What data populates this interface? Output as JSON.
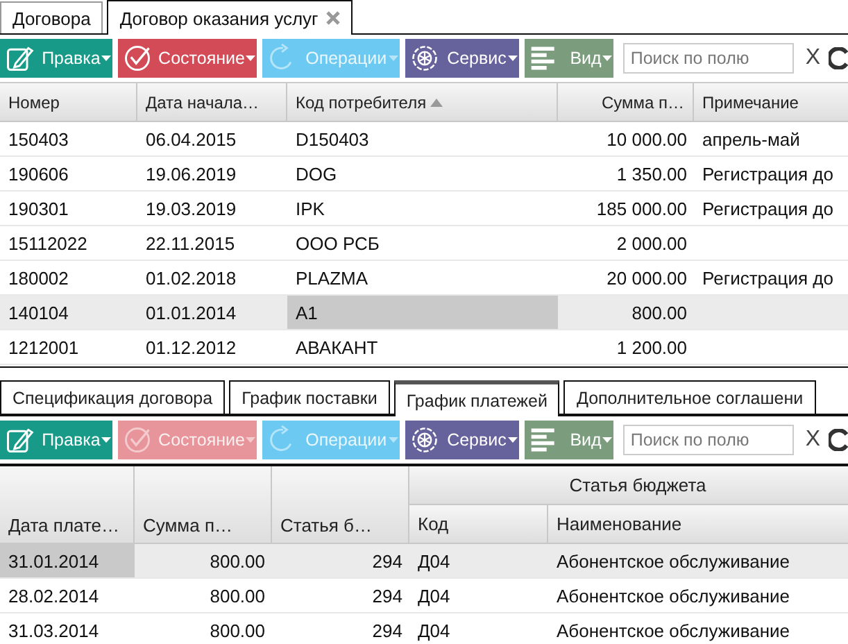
{
  "top_tabs": [
    {
      "label": "Договора",
      "selected": false,
      "closable": false
    },
    {
      "label": "Договор оказания услуг",
      "selected": true,
      "closable": true
    }
  ],
  "top_toolbar": {
    "buttons": [
      {
        "kind": "edit",
        "label": "Правка",
        "disabled": false
      },
      {
        "kind": "state",
        "label": "Состояние",
        "disabled": false
      },
      {
        "kind": "operations",
        "label": "Операции",
        "disabled": true
      },
      {
        "kind": "service",
        "label": "Сервис",
        "disabled": false
      },
      {
        "kind": "view",
        "label": "Вид",
        "disabled": false
      }
    ],
    "search": {
      "placeholder": "Поиск по полю"
    },
    "clear": "X"
  },
  "contracts_table": {
    "columns": [
      {
        "label": "Номер",
        "sorted_ascending": false,
        "focused": false
      },
      {
        "label": "Дата начала…",
        "sorted_ascending": false,
        "focused": false
      },
      {
        "label": "Код потребителя",
        "sorted_ascending": true,
        "focused": true
      },
      {
        "label": "Сумма п…",
        "sorted_ascending": false,
        "focused": false
      },
      {
        "label": "Примечание",
        "sorted_ascending": false,
        "focused": false
      }
    ],
    "rows": [
      {
        "number": "150403",
        "start_date": "06.04.2015",
        "consumer_code": "D150403",
        "amount": "10 000.00",
        "note": "апрель-май",
        "selected": false
      },
      {
        "number": "190606",
        "start_date": "19.06.2019",
        "consumer_code": "DOG",
        "amount": "1 350.00",
        "note": "Регистрация до",
        "selected": false
      },
      {
        "number": "190301",
        "start_date": "19.03.2019",
        "consumer_code": "IPK",
        "amount": "185 000.00",
        "note": "Регистрация до",
        "selected": false
      },
      {
        "number": "15112022",
        "start_date": "22.11.2015",
        "consumer_code": "ООО РСБ",
        "amount": "2 000.00",
        "note": "",
        "selected": false
      },
      {
        "number": "180002",
        "start_date": "01.02.2018",
        "consumer_code": "PLAZMA",
        "amount": "20 000.00",
        "note": "Регистрация до",
        "selected": false
      },
      {
        "number": "140104",
        "start_date": "01.01.2014",
        "consumer_code": "A1",
        "amount": "800.00",
        "note": "",
        "selected": true
      },
      {
        "number": "1212001",
        "start_date": "01.12.2012",
        "consumer_code": "АВАКАНТ",
        "amount": "1 200.00",
        "note": "",
        "selected": false
      }
    ]
  },
  "detail_tabs": [
    {
      "label": "Спецификация договора",
      "selected": false
    },
    {
      "label": "График поставки",
      "selected": false
    },
    {
      "label": "График платежей",
      "selected": true
    },
    {
      "label": "Дополнительное соглашени",
      "selected": false
    }
  ],
  "detail_toolbar": {
    "buttons": [
      {
        "kind": "edit",
        "label": "Правка",
        "disabled": false
      },
      {
        "kind": "state",
        "label": "Состояние",
        "disabled": true
      },
      {
        "kind": "operations",
        "label": "Операции",
        "disabled": true
      },
      {
        "kind": "service",
        "label": "Сервис",
        "disabled": false
      },
      {
        "kind": "view",
        "label": "Вид",
        "disabled": false
      }
    ],
    "search": {
      "placeholder": "Поиск по полю"
    },
    "clear": "X"
  },
  "payments_table": {
    "columns": [
      {
        "label": "Дата плате…",
        "focused": true
      },
      {
        "label": "Сумма п…",
        "focused": false
      },
      {
        "label": "Статья б…",
        "focused": false
      },
      {
        "label": "Код",
        "focused": false
      },
      {
        "label": "Наименование",
        "focused": false
      }
    ],
    "group_header": "Статья бюджета",
    "rows": [
      {
        "date": "31.01.2014",
        "amount": "800.00",
        "article": "294",
        "code": "Д04",
        "name": "Абонентское обслуживание",
        "selected": true
      },
      {
        "date": "28.02.2014",
        "amount": "800.00",
        "article": "294",
        "code": "Д04",
        "name": "Абонентское обслуживание",
        "selected": false
      },
      {
        "date": "31.03.2014",
        "amount": "800.00",
        "article": "294",
        "code": "Д04",
        "name": "Абонентское обслуживание",
        "selected": false
      }
    ]
  }
}
